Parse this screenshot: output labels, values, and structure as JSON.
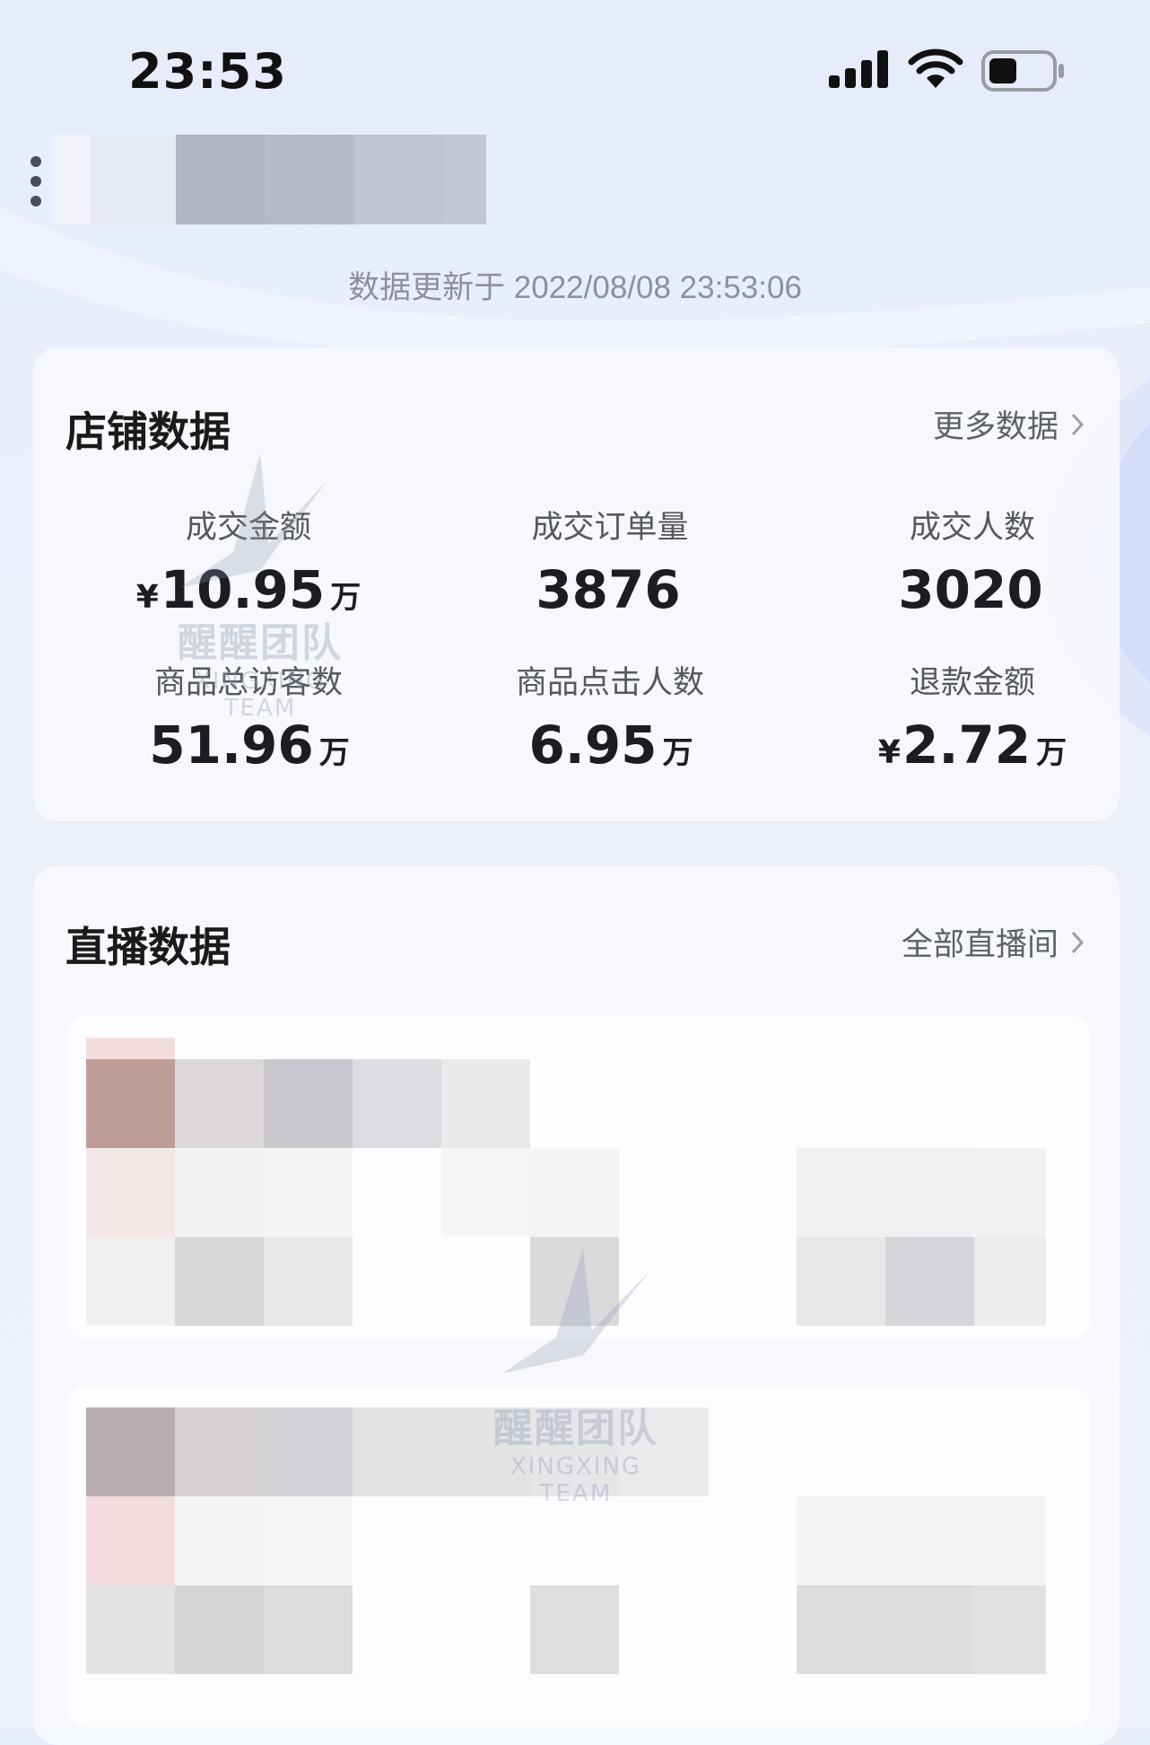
{
  "status_bar": {
    "time": "23:53"
  },
  "update_text": "数据更新于 2022/08/08 23:53:06",
  "store_card": {
    "title": "店铺数据",
    "link": "更多数据",
    "metrics": [
      {
        "label": "成交金额",
        "currency": "¥",
        "value": "10.95",
        "unit": "万"
      },
      {
        "label": "成交订单量",
        "currency": "",
        "value": "3876",
        "unit": ""
      },
      {
        "label": "成交人数",
        "currency": "",
        "value": "3020",
        "unit": ""
      },
      {
        "label": "商品总访客数",
        "currency": "",
        "value": "51.96",
        "unit": "万"
      },
      {
        "label": "商品点击人数",
        "currency": "",
        "value": "6.95",
        "unit": "万"
      },
      {
        "label": "退款金额",
        "currency": "¥",
        "value": "2.72",
        "unit": "万"
      }
    ]
  },
  "live_card": {
    "title": "直播数据",
    "link": "全部直播间"
  },
  "watermark": {
    "name": "醒醒团队",
    "sub": "XINGXING TEAM"
  },
  "icons": {
    "more": "more-vertical-icon",
    "signal": "cellular-signal-icon",
    "wifi": "wifi-icon",
    "battery": "battery-icon",
    "chevron": "chevron-right-icon"
  },
  "colors": {
    "accent_text": "#1b1d22",
    "muted": "#8d919c",
    "card_bg": "#f6f8fd"
  }
}
